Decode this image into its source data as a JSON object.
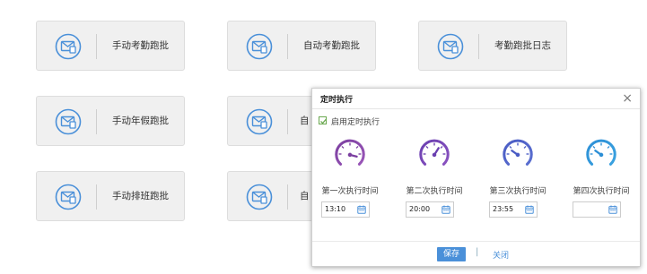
{
  "cards": [
    {
      "label": "手动考勤跑批"
    },
    {
      "label": "自动考勤跑批"
    },
    {
      "label": "考勤跑批日志"
    },
    {
      "label": "手动年假跑批"
    },
    {
      "label": "自"
    },
    {
      "label": "手动排班跑批"
    },
    {
      "label": "自"
    }
  ],
  "modal": {
    "title": "定时执行",
    "close_glyph": "×",
    "enable_label": "启用定时执行",
    "enable_checked": true,
    "columns": [
      {
        "label": "第一次执行时间",
        "time": "13:10",
        "color": "#7b3fa0"
      },
      {
        "label": "第二次执行时间",
        "time": "20:00",
        "color": "#6a3fb0"
      },
      {
        "label": "第三次执行时间",
        "time": "23:55",
        "color": "#4a5cc4"
      },
      {
        "label": "第四次执行时间",
        "time": "",
        "color": "#2c8fd6"
      }
    ],
    "save_label": "保存",
    "separator": "|",
    "close_label": "关闭"
  },
  "colors": {
    "accent": "#4a90d9",
    "card_bg": "#f0f0f0"
  }
}
